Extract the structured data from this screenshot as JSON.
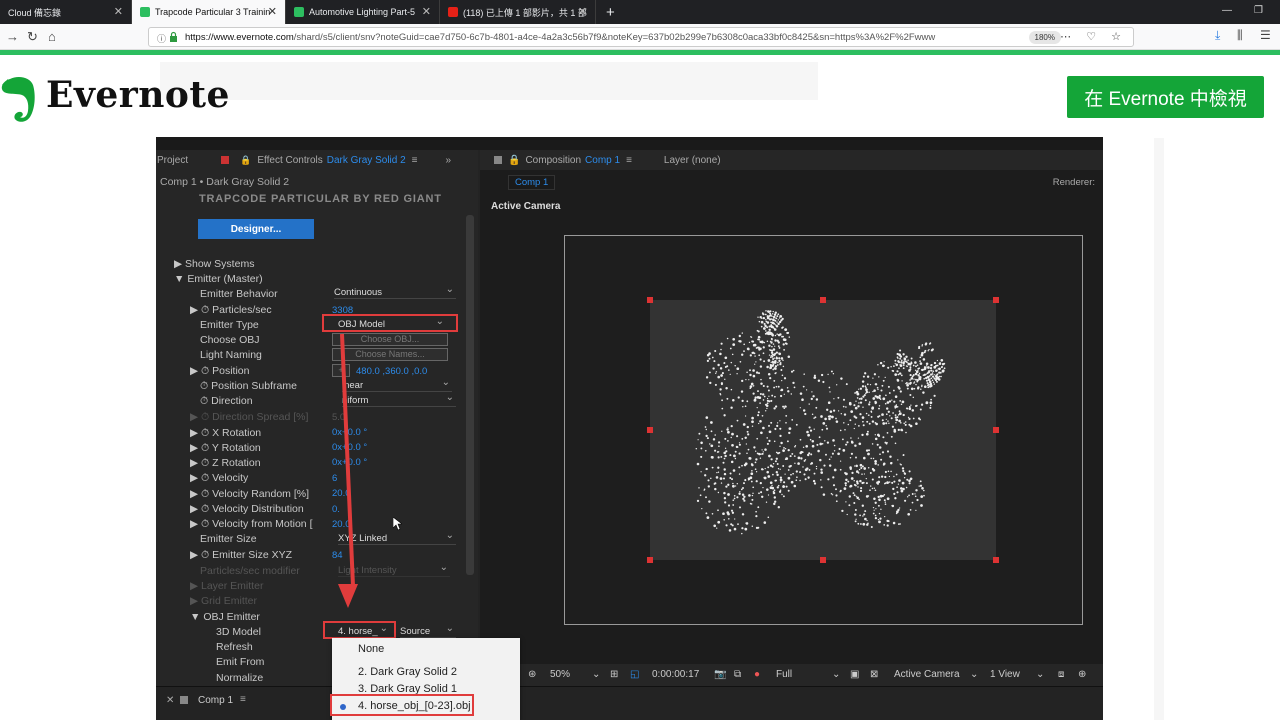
{
  "browser": {
    "tabs": [
      {
        "label": "Cloud 備忘錄",
        "active": false
      },
      {
        "label": "Trapcode Particular 3 Trainin",
        "active": true
      },
      {
        "label": "Automotive Lighting Part-5",
        "active": false
      },
      {
        "label": "(118) 已上傳 1 部影片，共 1 部",
        "active": false
      }
    ],
    "url_host": "https://www.evernote.com",
    "url_rest": "/shard/s5/client/snv?noteGuid=cae7d750-6c7b-4801-a4ce-4a2a3c56b7f9&noteKey=637b02b299e7b6308c0aca33bf0c8425&sn=https%3A%2F%2Fwww",
    "zoom": "180%"
  },
  "page": {
    "logo_text": "Evernote",
    "cta_label": "在 Evernote 中檢視"
  },
  "ae": {
    "left_tabs": {
      "project": "Project",
      "effect_controls": "Effect Controls",
      "layer_name": "Dark Gray Solid 2"
    },
    "layer_path": "Comp 1 • Dark Gray Solid 2",
    "plugin_title": "TRAPCODE PARTICULAR BY RED GIANT",
    "designer_label": "Designer...",
    "comp_tabs": {
      "composition": "Composition",
      "comp_name": "Comp 1",
      "layer": "Layer  (none)"
    },
    "comp_tab_chip": "Comp 1",
    "renderer_label": "Renderer:",
    "active_camera": "Active Camera",
    "props": {
      "show_systems": "Show Systems",
      "emitter_master": "Emitter (Master)",
      "emitter_behavior": "Emitter Behavior",
      "particles_sec": "Particles/sec",
      "emitter_type": "Emitter Type",
      "choose_obj": "Choose OBJ",
      "light_naming": "Light Naming",
      "position": "Position",
      "position_subframe": "Position Subframe",
      "direction": "Direction",
      "direction_spread": "Direction Spread [%]",
      "x_rotation": "X Rotation",
      "y_rotation": "Y Rotation",
      "z_rotation": "Z Rotation",
      "velocity": "Velocity",
      "velocity_random": "Velocity Random [%]",
      "velocity_distribution": "Velocity Distribution",
      "velocity_from_motion": "Velocity from Motion [",
      "emitter_size": "Emitter Size",
      "emitter_size_xyz": "Emitter Size XYZ",
      "particles_sec_modifier": "Particles/sec modifier",
      "layer_emitter": "Layer Emitter",
      "grid_emitter": "Grid Emitter",
      "obj_emitter": "OBJ Emitter",
      "model_3d": "3D Model",
      "refresh": "Refresh",
      "emit_from": "Emit From",
      "normalize": "Normalize"
    },
    "values": {
      "emitter_behavior": "Continuous",
      "particles_sec": "3308",
      "emitter_type": "OBJ Model",
      "choose_obj_btn": "Choose OBJ...",
      "choose_names_btn": "Choose Names...",
      "position": "480.0 ,360.0 ,0.0",
      "position_subframe": "inear",
      "direction": "niform",
      "direction_spread": "5.0",
      "x_rotation": "0x+0.0 °",
      "y_rotation": "0x+0.0 °",
      "z_rotation": "0x+0.0 °",
      "velocity": "6",
      "velocity_random": "20.0",
      "velocity_distribution": "0.",
      "velocity_from_motion": "20.0",
      "emitter_size": "XYZ Linked",
      "emitter_size_xyz": "84",
      "particles_sec_modifier": "Light Intensity",
      "model_3d": "4. horse_",
      "model_source": "Source"
    },
    "viewer": {
      "zoom": "50%",
      "timecode": "0:00:00:17",
      "resolution": "Full",
      "camera": "Active Camera",
      "views": "1 View"
    },
    "bottom_tab": "Comp 1",
    "popup_items": [
      "None",
      "2. Dark Gray Solid 2",
      "3. Dark Gray Solid 1",
      "4. horse_obj_[0-23].obj"
    ]
  },
  "colors": {
    "evernote_green": "#14a538",
    "ae_blue": "#2d8ceb",
    "highlight_red": "#e03c3c"
  }
}
